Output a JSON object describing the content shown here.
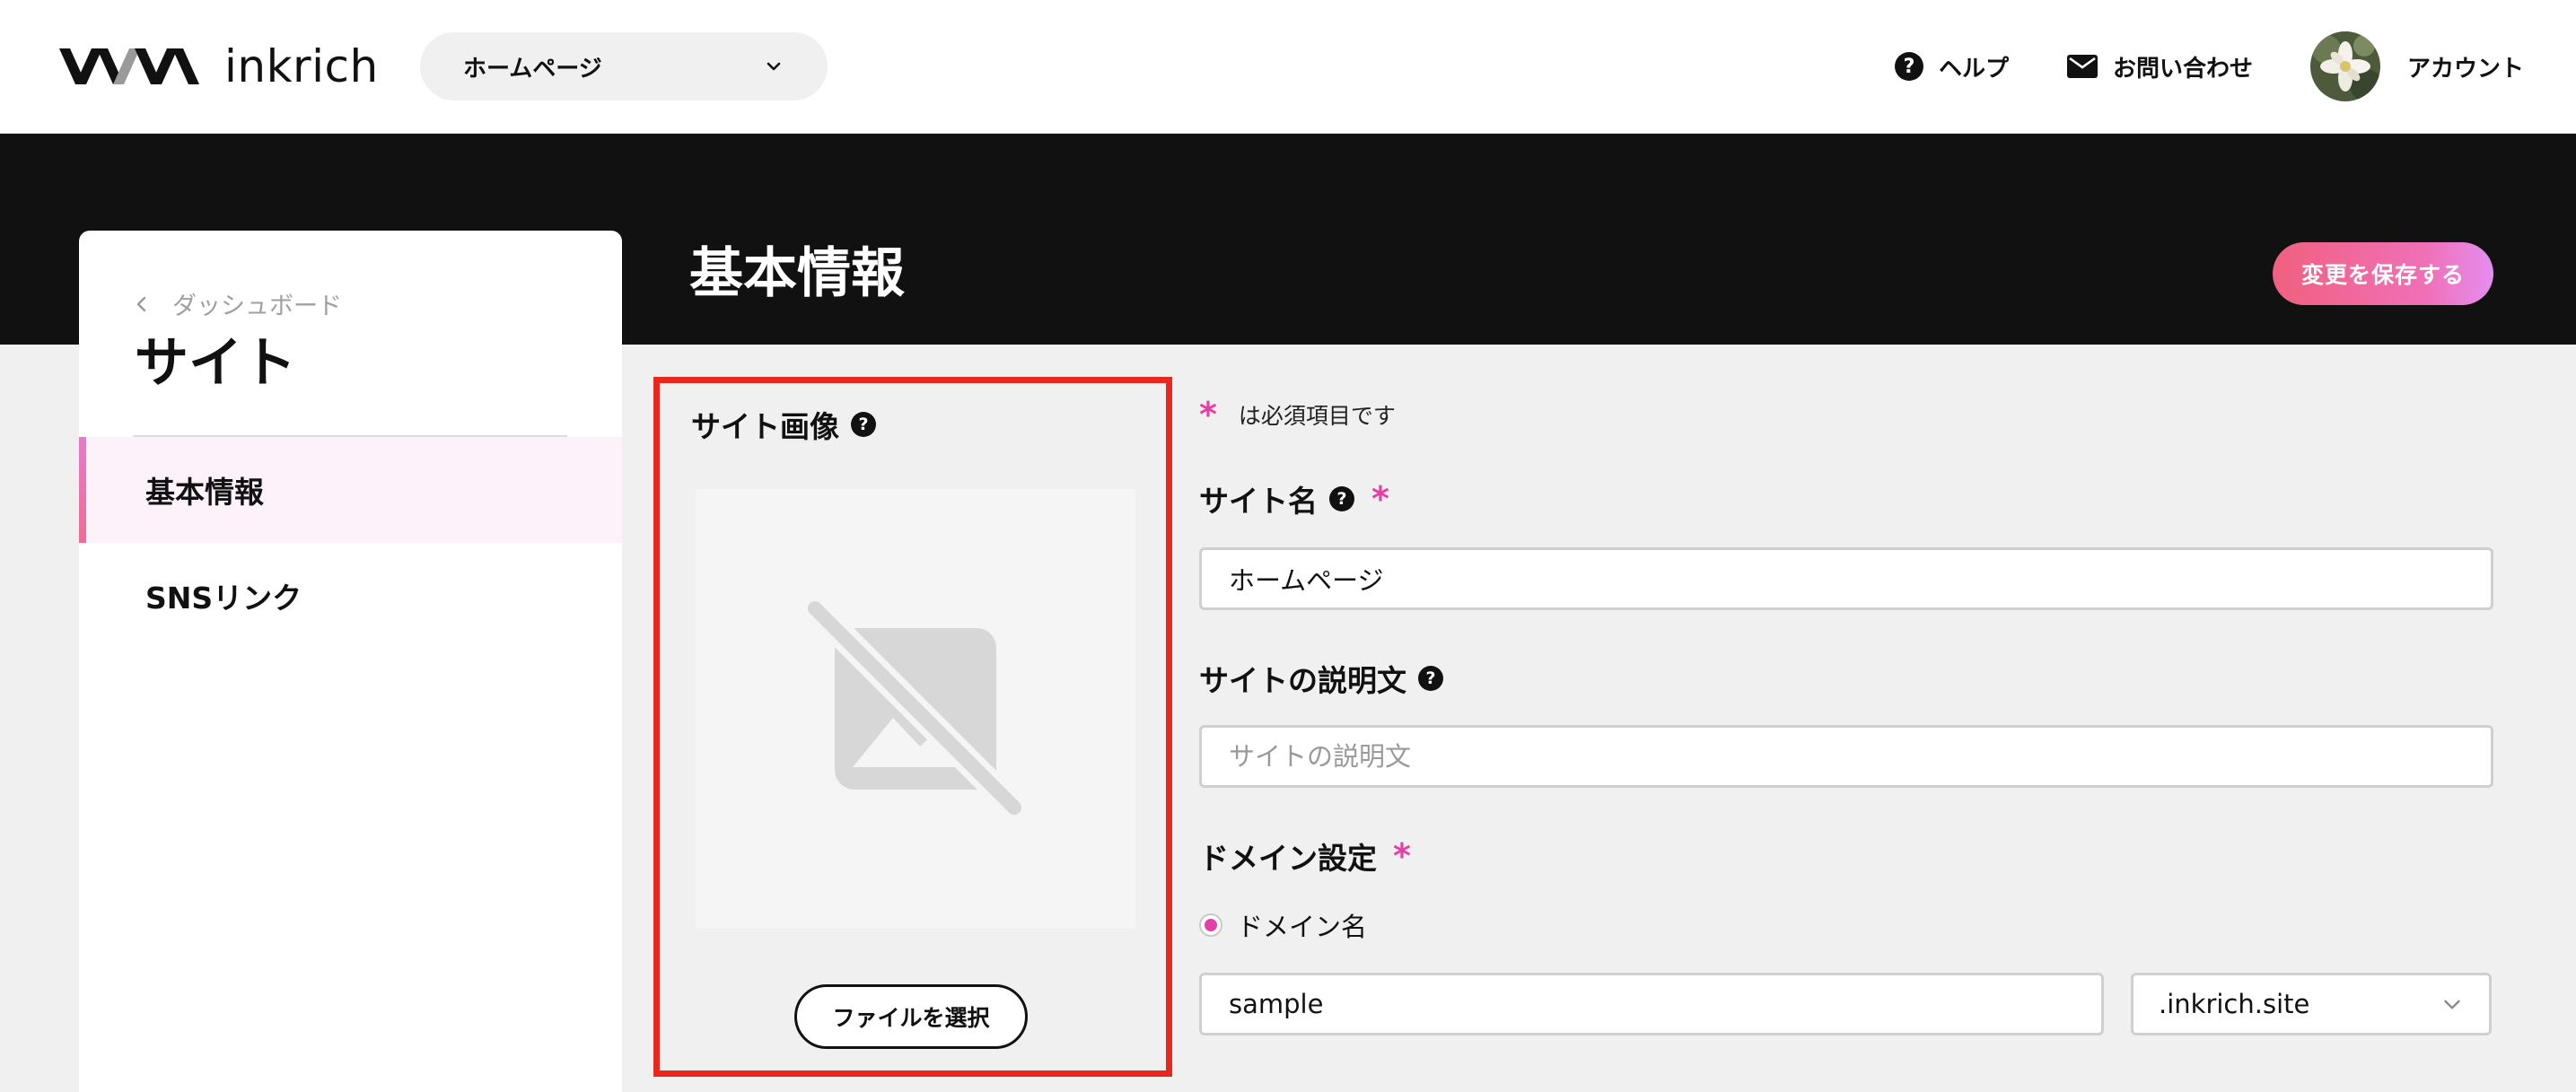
{
  "header": {
    "brand": "inkrich",
    "site_select": {
      "value": "ホームページ"
    },
    "help_label": "ヘルプ",
    "contact_label": "お問い合わせ",
    "account_label": "アカウント"
  },
  "page": {
    "title": "基本情報",
    "save_label": "変更を保存する"
  },
  "sidebar": {
    "back_label": "ダッシュボード",
    "title": "サイト",
    "items": [
      {
        "label": "基本情報",
        "active": true
      },
      {
        "label": "SNSリンク",
        "active": false
      }
    ]
  },
  "image_section": {
    "title": "サイト画像",
    "file_button": "ファイルを選択"
  },
  "form": {
    "required_note": "は必須項目です",
    "required_mark": "*",
    "site_name": {
      "label": "サイト名",
      "value": "ホームページ"
    },
    "description": {
      "label": "サイトの説明文",
      "placeholder": "サイトの説明文",
      "value": ""
    },
    "domain": {
      "label": "ドメイン設定",
      "option_label": "ドメイン名",
      "value": "sample",
      "suffix": ".inkrich.site"
    }
  },
  "colors": {
    "accent_pink": "#e23fa7",
    "highlight_border": "#e8281e",
    "band": "#111111"
  }
}
